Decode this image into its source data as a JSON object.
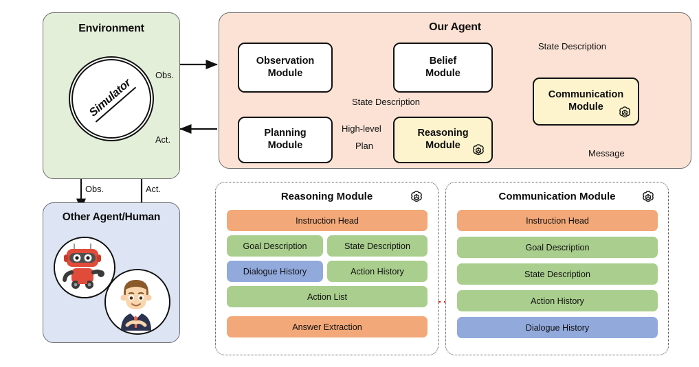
{
  "environment": {
    "title": "Environment",
    "simulator_label": "Simulator"
  },
  "our_agent": {
    "title": "Our Agent",
    "modules": {
      "observation": {
        "line1": "Observation",
        "line2": "Module"
      },
      "belief": {
        "line1": "Belief",
        "line2": "Module"
      },
      "communication": {
        "line1": "Communication",
        "line2": "Module"
      },
      "planning": {
        "line1": "Planning",
        "line2": "Module"
      },
      "reasoning": {
        "line1": "Reasoning",
        "line2": "Module"
      }
    },
    "edge_labels": {
      "state_description_top": "State Description",
      "state_description_mid": "State Description",
      "high_level": "High-level",
      "plan": "Plan",
      "message": "Message"
    }
  },
  "environment_edges": {
    "obs_right": "Obs.",
    "act_right": "Act.",
    "obs_down": "Obs.",
    "act_up": "Act."
  },
  "other_agent": {
    "title": "Other Agent/Human",
    "avatars": [
      {
        "name": "robot-avatar"
      },
      {
        "name": "human-avatar"
      }
    ]
  },
  "reasoning_panel": {
    "title": "Reasoning Module",
    "rows": [
      {
        "cells": [
          {
            "label": "Instruction Head",
            "color": "orange",
            "span": "full"
          }
        ]
      },
      {
        "cells": [
          {
            "label": "Goal Description",
            "color": "green",
            "span": "half"
          },
          {
            "label": "State Description",
            "color": "green",
            "span": "half"
          }
        ]
      },
      {
        "cells": [
          {
            "label": "Dialogue History",
            "color": "blue",
            "span": "half"
          },
          {
            "label": "Action History",
            "color": "green",
            "span": "half"
          }
        ]
      },
      {
        "cells": [
          {
            "label": "Action List",
            "color": "green",
            "span": "full"
          }
        ]
      },
      {
        "cells": [
          {
            "label": "Answer Extraction",
            "color": "orange",
            "span": "full"
          }
        ]
      }
    ]
  },
  "communication_panel": {
    "title": "Communication Module",
    "rows": [
      {
        "label": "Instruction Head",
        "color": "orange"
      },
      {
        "label": "Goal Description",
        "color": "green"
      },
      {
        "label": "State Description",
        "color": "green"
      },
      {
        "label": "Action History",
        "color": "green"
      },
      {
        "label": "Dialogue History",
        "color": "blue"
      }
    ]
  },
  "colors": {
    "environment_bg": "#e4efda",
    "agent_bg": "#fbe2d5",
    "other_agent_bg": "#dde4f3",
    "module_yellow": "#fdf3cd",
    "bar_orange": "#f2a878",
    "bar_green": "#a9ce8d",
    "bar_blue": "#92a9dc",
    "red_arrow": "#d61f1f",
    "stroke": "#111111"
  }
}
